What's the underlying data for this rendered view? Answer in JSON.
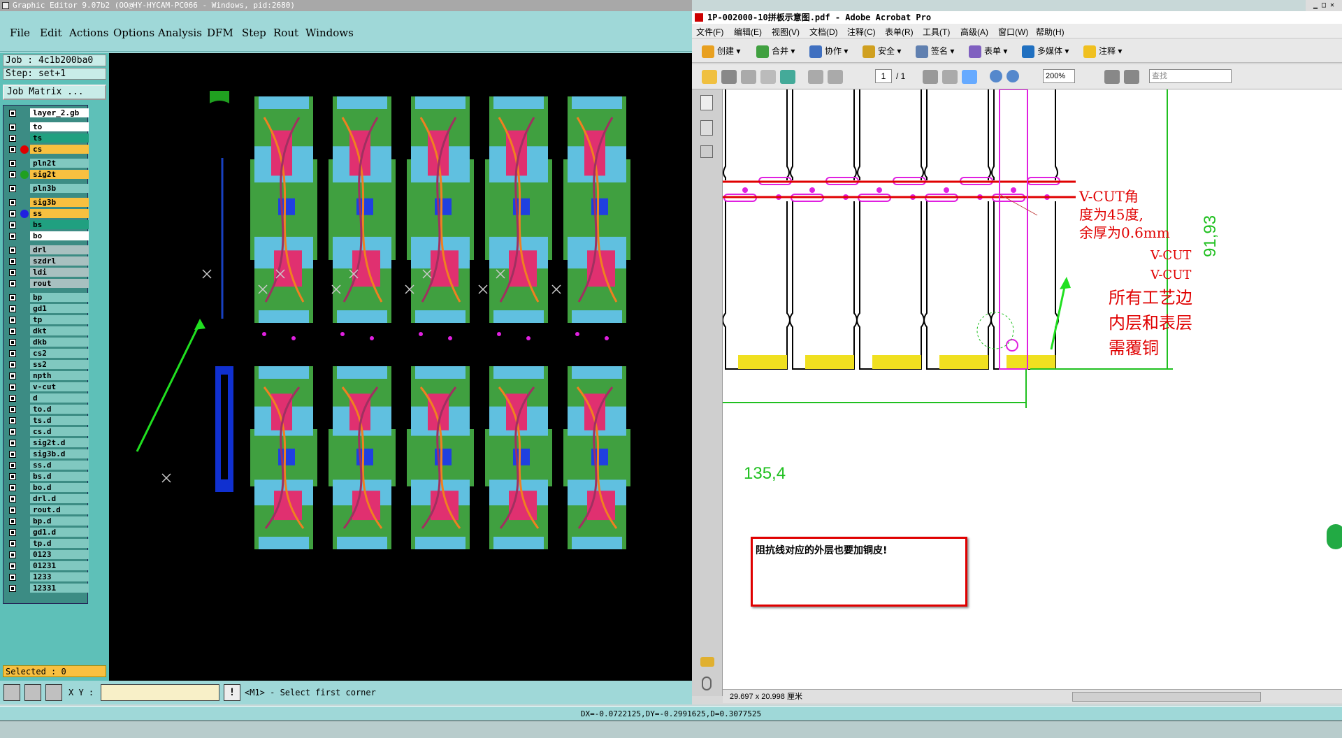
{
  "ge": {
    "title": "Graphic Editor 9.07b2 (OO@HY-HYCAM-PC066 - Windows, pid:2680)",
    "menu": [
      "File",
      "Edit",
      "Actions",
      "Options",
      "Analysis",
      "DFM",
      "Step",
      "Rout",
      "Windows"
    ],
    "job": "Job : 4c1b200ba0",
    "step": "Step: set+1",
    "job_matrix": "Job Matrix ...",
    "layers": [
      "layer_2.gb",
      "to",
      "ts",
      "cs",
      "pln2t",
      "sig2t",
      "pln3b",
      "sig3b",
      "ss",
      "bs",
      "bo",
      "drl",
      "szdrl",
      "ldi",
      "rout",
      "bp",
      "gd1",
      "tp",
      "dkt",
      "dkb",
      "cs2",
      "ss2",
      "npth",
      "v-cut",
      "d",
      "to.d",
      "ts.d",
      "cs.d",
      "sig2t.d",
      "sig3b.d",
      "ss.d",
      "bs.d",
      "bo.d",
      "drl.d",
      "rout.d",
      "bp.d",
      "gd1.d",
      "tp.d",
      "0123",
      "01231",
      "1233",
      "12331"
    ],
    "selected": "Selected : 0",
    "xy_label": "X Y :",
    "prompt": "<M1> - Select first corner",
    "status": "DX=-0.0722125,DY=-0.2991625,D=0.3077525",
    "colors": {
      "panel": "#9fd8d8",
      "layer_orange": "#f8c040",
      "layer_green": "#20a080",
      "layer_white": "#ffffff",
      "layer_grey": "#a8c0c0",
      "canvas": "#000000"
    }
  },
  "acrobat": {
    "title": "1P-002000-10拼板示意图.pdf - Adobe Acrobat Pro",
    "menu": [
      "文件(F)",
      "编辑(E)",
      "视图(V)",
      "文档(D)",
      "注释(C)",
      "表单(R)",
      "工具(T)",
      "高级(A)",
      "窗口(W)",
      "帮助(H)"
    ],
    "toolbar1": [
      "创建",
      "合并",
      "协作",
      "安全",
      "签名",
      "表单",
      "多媒体",
      "注释"
    ],
    "page_current": "1",
    "page_total": "/ 1",
    "zoom": "200%",
    "find_placeholder": "查找",
    "status": "29.697 x 20.998 厘米",
    "doc": {
      "vcut_note_line1": "V-CUT角",
      "vcut_note_line2": "度为45度,",
      "vcut_note_line3": "余厚为0.6mm",
      "vcut_label_1": "V-CUT",
      "vcut_label_2": "V-CUT",
      "copper_note_line1": "所有工艺边",
      "copper_note_line2": "内层和表层",
      "copper_note_line3": "需覆铜",
      "dim_vertical": "91,93",
      "dim_horizontal": "135,4",
      "impedance_note": "阻抗线对应的外层也要加铜皮!"
    }
  }
}
